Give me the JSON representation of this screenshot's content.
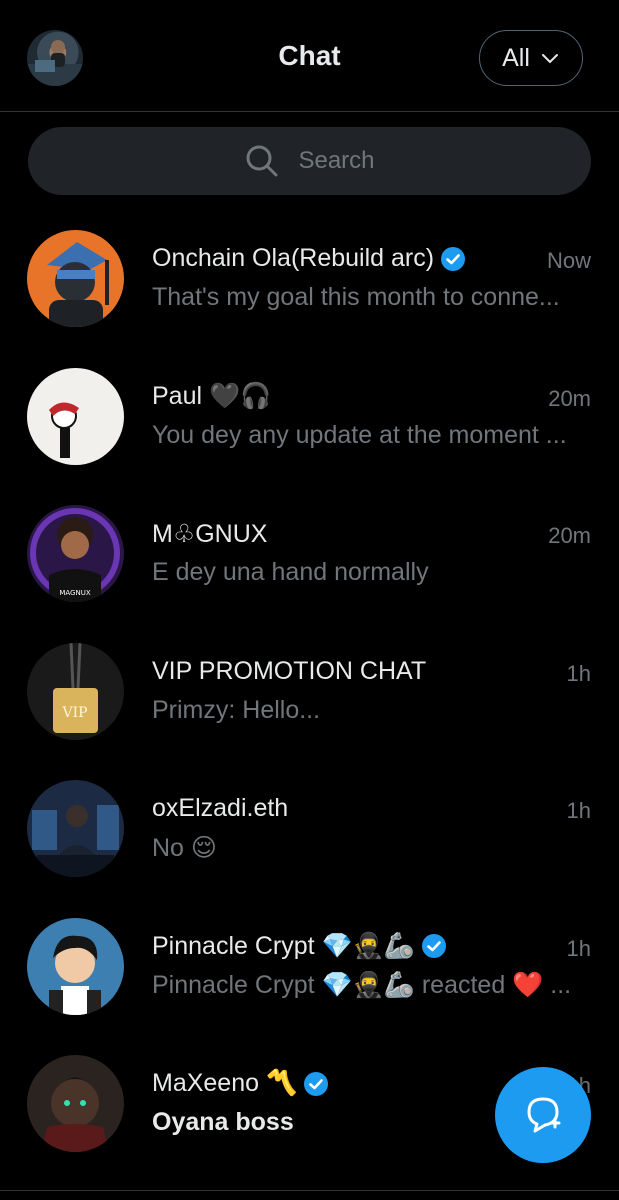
{
  "header": {
    "title": "Chat",
    "filter_label": "All"
  },
  "search": {
    "placeholder": "Search"
  },
  "conversations": [
    {
      "name": "Onchain Ola(Rebuild arc)",
      "verified": true,
      "time": "Now",
      "message": "That's my goal this month to conne...",
      "unread": false,
      "avatar_color": "#e8742a"
    },
    {
      "name": "Paul 🖤🎧",
      "verified": false,
      "time": "20m",
      "message": "You dey any update at the moment ...",
      "unread": false,
      "avatar_color": "#f2f0ec"
    },
    {
      "name": "M♧GNUX",
      "verified": false,
      "time": "20m",
      "message": "E dey una hand normally",
      "unread": false,
      "avatar_color": "#4b2a7a"
    },
    {
      "name": "VIP PROMOTION CHAT",
      "verified": false,
      "time": "1h",
      "message": "Primzy: Hello...",
      "unread": false,
      "avatar_color": "#1a1a1a"
    },
    {
      "name": "oxElzadi.eth",
      "verified": false,
      "time": "1h",
      "message": "No 😌",
      "unread": false,
      "avatar_color": "#2b4a6e"
    },
    {
      "name": "Pinnacle Crypt 💎🥷🦾",
      "verified": true,
      "time": "1h",
      "message": "Pinnacle Crypt 💎🥷🦾 reacted ❤️ ...",
      "unread": false,
      "avatar_color": "#4a8fb8"
    },
    {
      "name": "MaXeeno 〽️",
      "verified": true,
      "time": "1h",
      "message": "Oyana boss",
      "unread": true,
      "avatar_color": "#2a2320"
    }
  ],
  "colors": {
    "accent": "#1d9bf0",
    "background": "#000000",
    "muted": "#71767b"
  },
  "icons": {
    "search": "search-icon",
    "new_message": "new-message-icon",
    "verified": "verified-badge-icon",
    "chevron": "chevron-down-icon"
  }
}
